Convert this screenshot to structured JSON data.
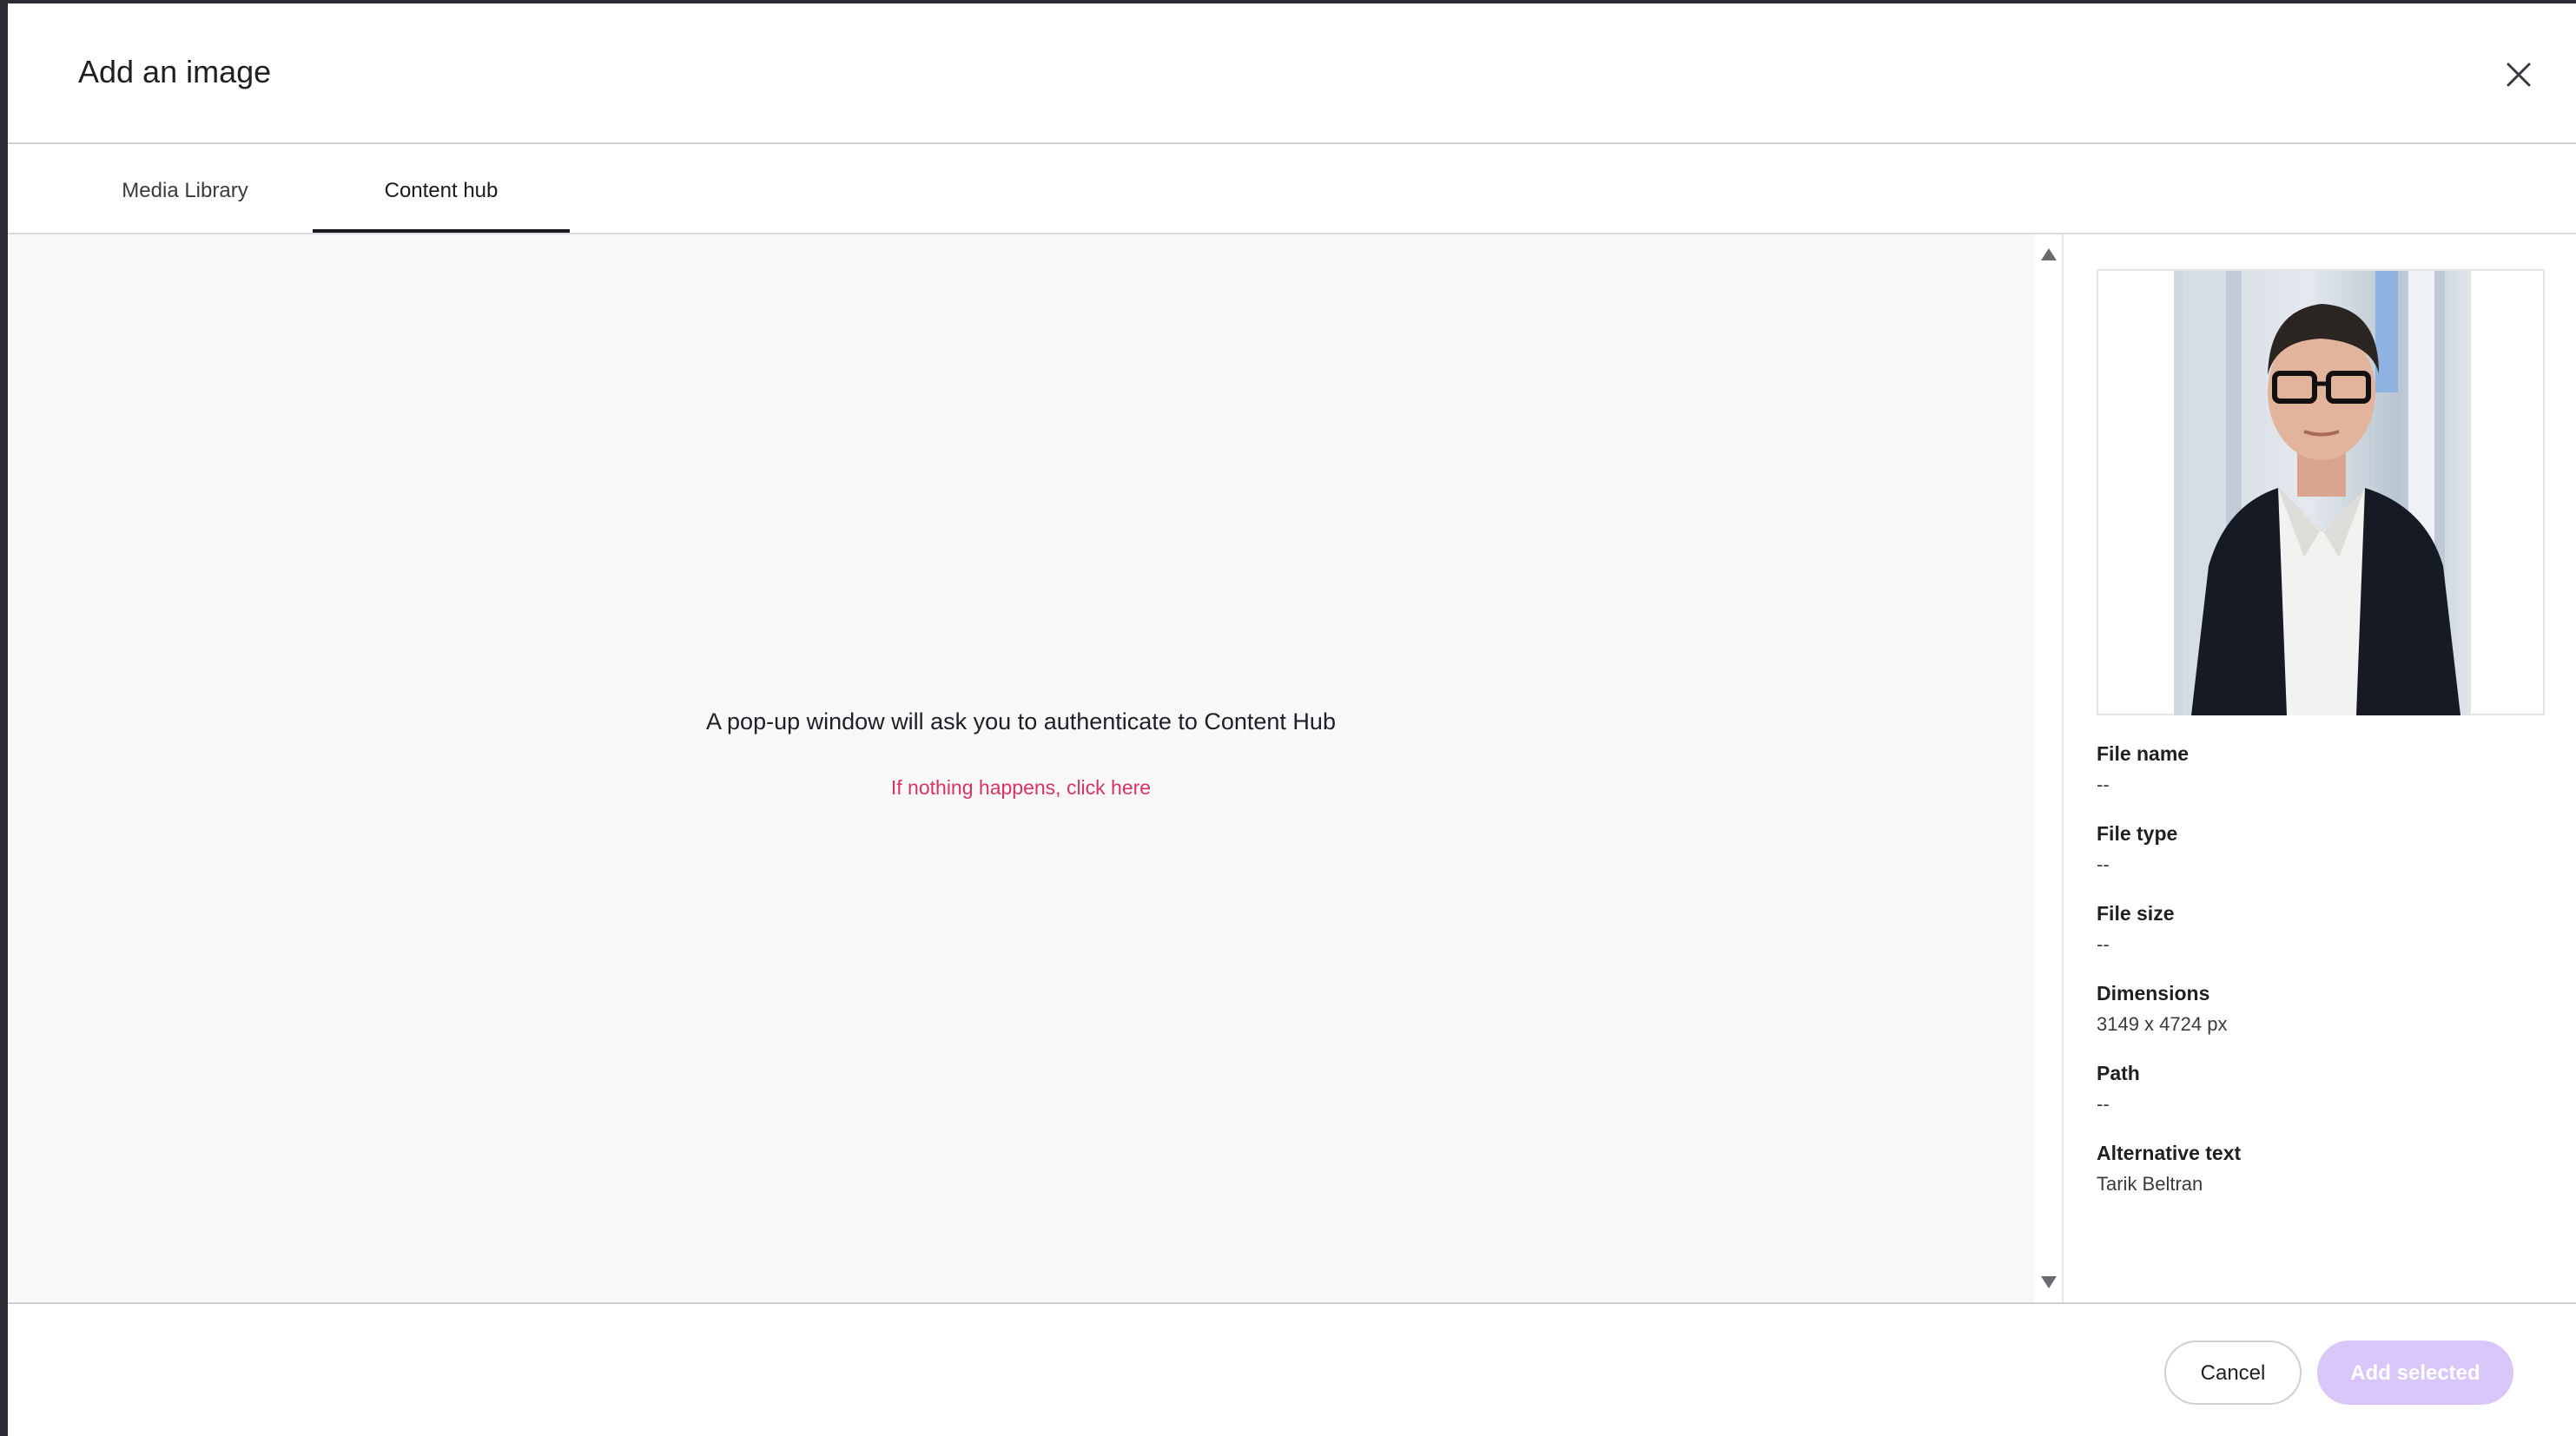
{
  "dialog": {
    "title": "Add an image"
  },
  "tabs": [
    {
      "label": "Media Library",
      "active": false
    },
    {
      "label": "Content hub",
      "active": true
    }
  ],
  "main": {
    "message": "A pop-up window will ask you to authenticate to Content Hub",
    "link_text": "If nothing happens, click here"
  },
  "details": {
    "items": [
      {
        "label": "File name",
        "value": "--"
      },
      {
        "label": "File type",
        "value": "--"
      },
      {
        "label": "File size",
        "value": "--"
      },
      {
        "label": "Dimensions",
        "value": "3149 x 4724 px"
      },
      {
        "label": "Path",
        "value": "--"
      },
      {
        "label": "Alternative text",
        "value": "Tarik Beltran"
      }
    ]
  },
  "footer": {
    "cancel_label": "Cancel",
    "add_label": "Add selected"
  },
  "colors": {
    "link": "#d8345f",
    "primary_disabled": "#d8c7f8",
    "active_tab": "#1a1a1f"
  },
  "icons": {
    "close": "close-icon",
    "scroll_up": "arrow-up-icon",
    "scroll_down": "arrow-down-icon"
  }
}
